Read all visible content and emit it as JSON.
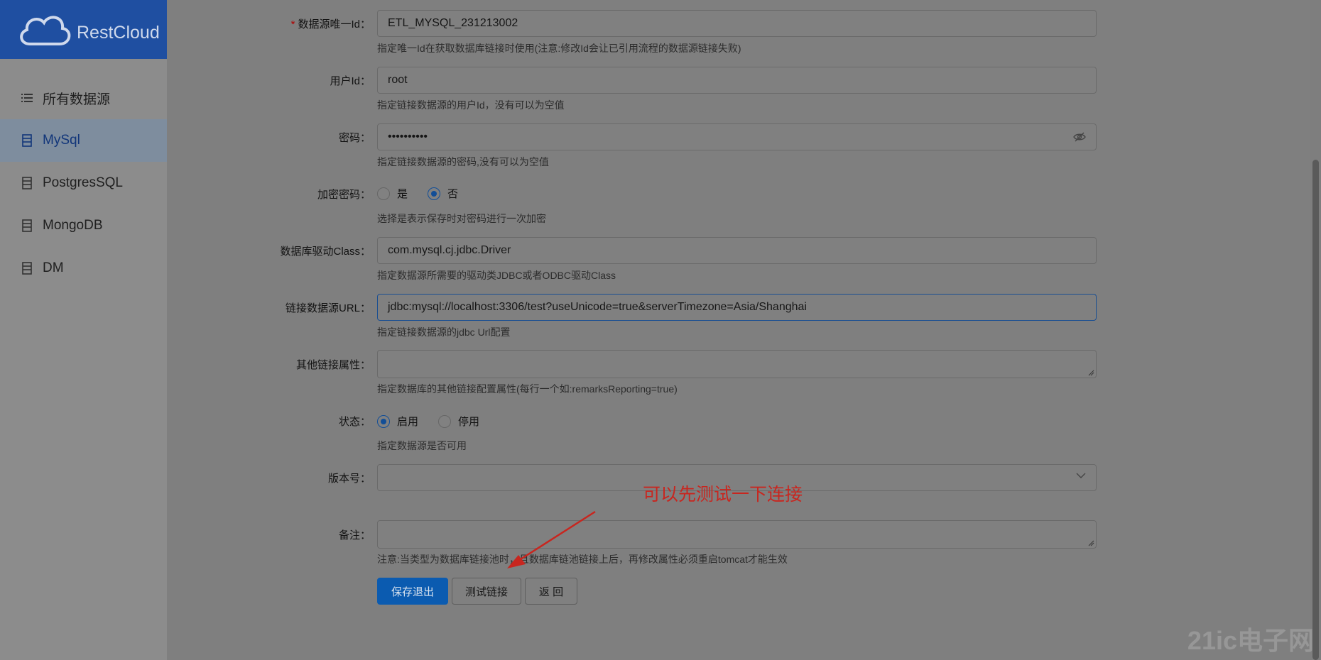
{
  "app": {
    "logo_text": "RestCloud"
  },
  "sidebar": {
    "items": [
      {
        "label": "所有数据源",
        "icon": "list-icon",
        "active": false
      },
      {
        "label": "MySql",
        "icon": "database-icon",
        "active": true
      },
      {
        "label": "PostgresSQL",
        "icon": "database-icon",
        "active": false
      },
      {
        "label": "MongoDB",
        "icon": "database-icon",
        "active": false
      },
      {
        "label": "DM",
        "icon": "database-icon",
        "active": false
      }
    ]
  },
  "form": {
    "id": {
      "label": "数据源唯一Id：",
      "required_mark": "*",
      "value": "ETL_MYSQL_231213002",
      "help": "指定唯一Id在获取数据库链接时使用(注意:修改Id会让已引用流程的数据源链接失败)"
    },
    "user": {
      "label": "用户Id：",
      "value": "root",
      "help": "指定链接数据源的用户Id，没有可以为空值"
    },
    "password": {
      "label": "密码：",
      "value": "••••••••••",
      "help": "指定链接数据源的密码,没有可以为空值"
    },
    "encrypt": {
      "label": "加密密码：",
      "options": [
        "是",
        "否"
      ],
      "selected": "否",
      "help": "选择是表示保存时对密码进行一次加密"
    },
    "driver": {
      "label": "数据库驱动Class：",
      "value": "com.mysql.cj.jdbc.Driver",
      "help": "指定数据源所需要的驱动类JDBC或者ODBC驱动Class"
    },
    "url": {
      "label": "链接数据源URL：",
      "value": "jdbc:mysql://localhost:3306/test?useUnicode=true&serverTimezone=Asia/Shanghai",
      "help": "指定链接数据源的jdbc Url配置"
    },
    "props": {
      "label": "其他链接属性：",
      "value": "",
      "help": "指定数据库的其他链接配置属性(每行一个如:remarksReporting=true)"
    },
    "status": {
      "label": "状态：",
      "options": [
        "启用",
        "停用"
      ],
      "selected": "启用",
      "help": "指定数据源是否可用"
    },
    "version": {
      "label": "版本号：",
      "value": ""
    },
    "remark": {
      "label": "备注：",
      "value": "",
      "help": "注意:当类型为数据库链接池时，且数据库链池链接上后，再修改属性必须重启tomcat才能生效"
    }
  },
  "buttons": {
    "save": "保存退出",
    "test": "测试链接",
    "back": "返 回"
  },
  "annotation": {
    "text": "可以先测试一下连接",
    "color": "#c8261f"
  },
  "watermark": "21ic电子网",
  "colors": {
    "brand": "#1f4fa1",
    "primary": "#0b5bb0"
  }
}
